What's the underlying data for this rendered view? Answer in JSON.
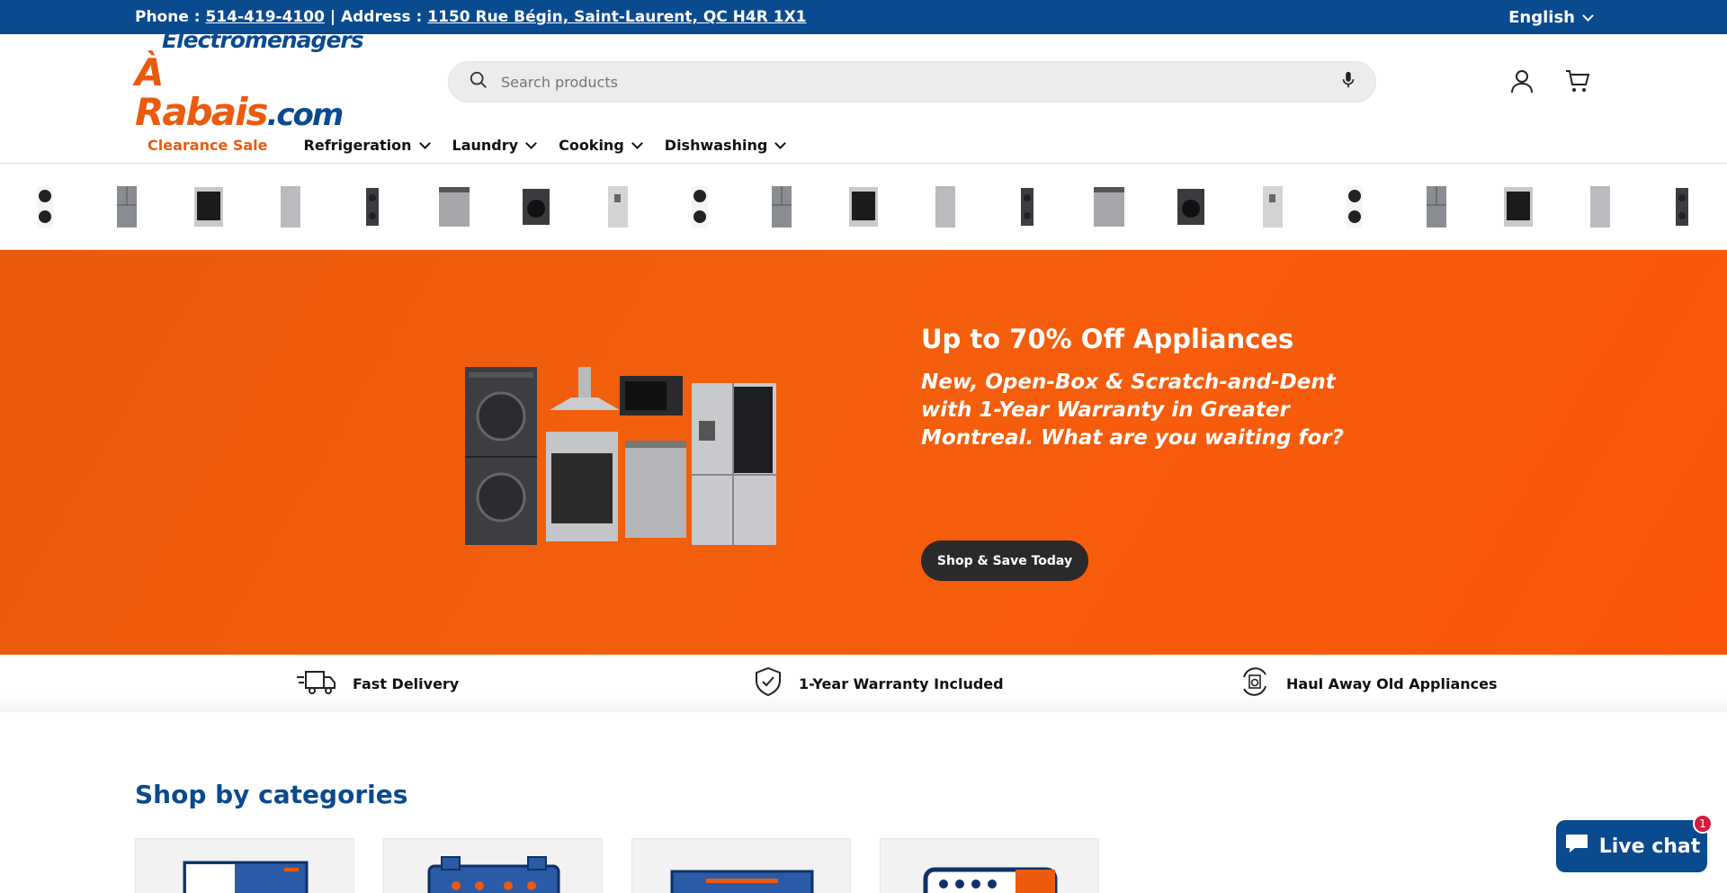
{
  "topbar": {
    "phone_label": "Phone : ",
    "phone": "514-419-4100",
    "address_label": " | Address : ",
    "address": "1150 Rue Bégin, Saint-Laurent, QC H4R 1X1",
    "language": "English"
  },
  "logo": {
    "line1": "Électroménagers",
    "line2a": "À Rabais",
    "line2b": ".com"
  },
  "search": {
    "placeholder": "Search products"
  },
  "nav": {
    "sale": "Clearance Sale",
    "items": [
      "Refrigeration",
      "Laundry",
      "Cooking",
      "Dishwashing"
    ]
  },
  "hero": {
    "title": "Up to 70% Off Appliances",
    "subtitle": "New, Open-Box & Scratch-and-Dent with 1-Year Warranty in Greater Montreal. What are you waiting for?",
    "button": "Shop & Save Today"
  },
  "features": [
    "Fast Delivery",
    "1-Year Warranty Included",
    "Haul Away Old Appliances"
  ],
  "categories": {
    "heading": "Shop by categories"
  },
  "chat": {
    "label": "Live chat",
    "badge": "1"
  },
  "colors": {
    "brand_blue": "#0a4a8f",
    "brand_orange": "#ec5a0e"
  }
}
